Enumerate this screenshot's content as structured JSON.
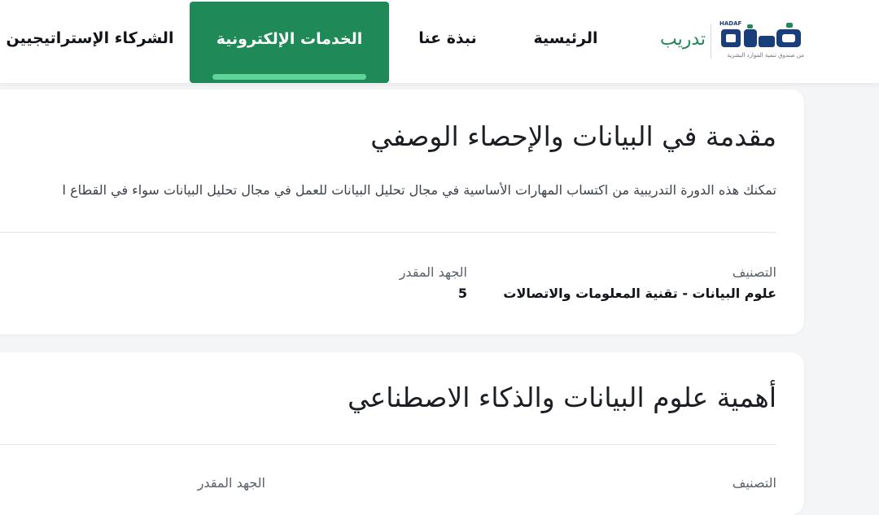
{
  "header": {
    "logo": {
      "latin": "HADAF",
      "arabic": "هدف",
      "caption": "من صندوق تنمية الموارد البشرية",
      "colors": {
        "primary": "#1a3e7a",
        "accent": "#1f8a58"
      }
    },
    "brand": "تدريب",
    "nav": [
      {
        "label": "الرئيسية",
        "active": false
      },
      {
        "label": "نبذة عنا",
        "active": false
      },
      {
        "label": "الخدمات الإلكترونية",
        "active": true
      },
      {
        "label": "الشركاء الإستراتيجيين",
        "active": false
      }
    ]
  },
  "courses": [
    {
      "title": "مقدمة في البيانات والإحصاء الوصفي",
      "description": "تمكنك هذه الدورة التدريبية من اكتساب المهارات الأساسية في مجال تحليل البيانات للعمل في مجال تحليل البيانات سواء في القطاع ا",
      "classification_label": "التصنيف",
      "classification_value": "علوم البيانات - تقنية المعلومات والاتصالات",
      "effort_label": "الجهد المقدر",
      "effort_value": "5"
    },
    {
      "title": "أهمية علوم البيانات والذكاء الاصطناعي",
      "classification_label": "التصنيف",
      "effort_label": "الجهد المقدر"
    }
  ],
  "colors": {
    "brand_green": "#1f8a58",
    "active_bar": "#5fd39a",
    "background": "#f4f5f7"
  }
}
